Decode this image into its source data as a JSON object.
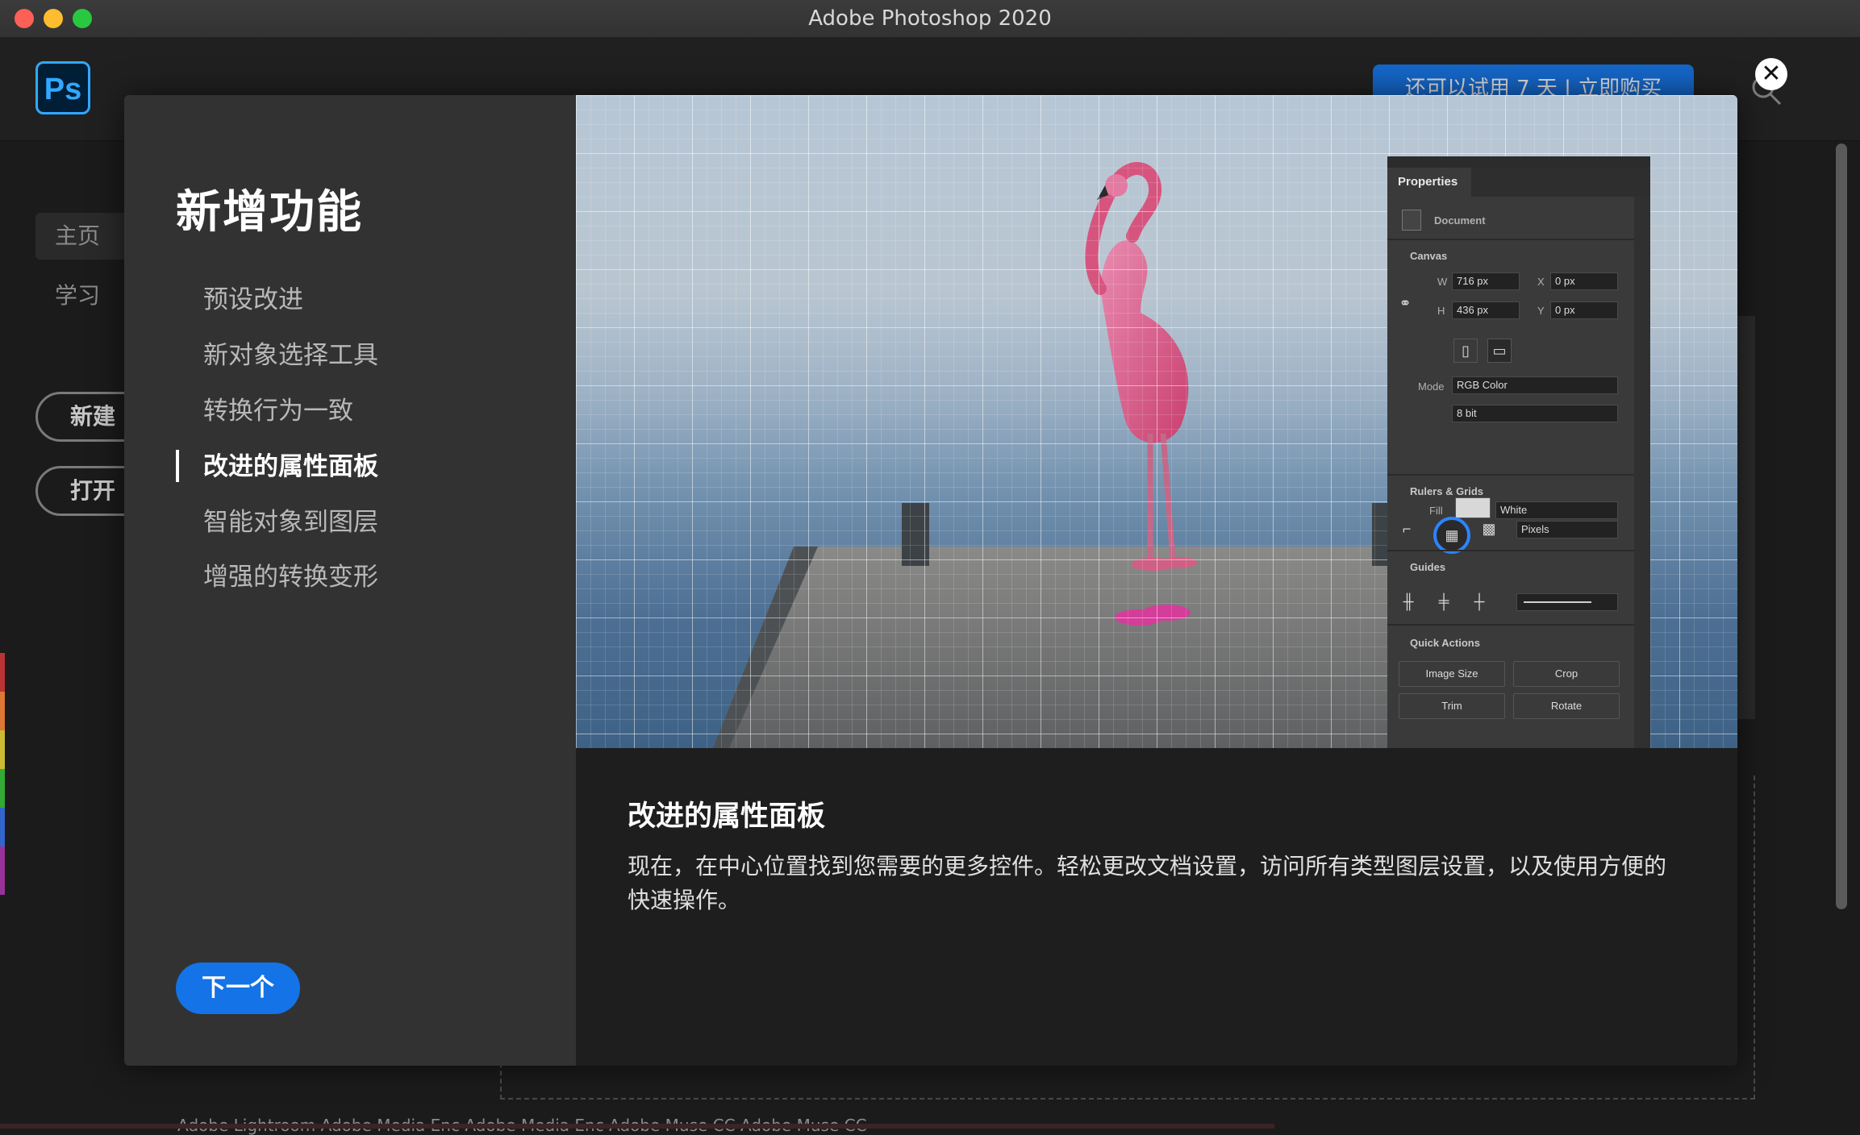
{
  "window": {
    "title": "Adobe Photoshop 2020"
  },
  "app": {
    "logo": "Ps",
    "trial_banner": "还可以试用 7 天 | 立即购买",
    "sidebar": {
      "items": [
        {
          "label": "主页"
        },
        {
          "label": "学习"
        }
      ]
    },
    "buttons": {
      "new": "新建",
      "open": "打开"
    },
    "footer_apps": "Adobe Lightroom  Adobe Media Enc  Adobe Media Enc  Adobe Muse CC  Adobe Muse CC"
  },
  "modal": {
    "title": "新增功能",
    "features": [
      {
        "label": "预设改进"
      },
      {
        "label": "新对象选择工具"
      },
      {
        "label": "转换行为一致"
      },
      {
        "label": "改进的属性面板"
      },
      {
        "label": "智能对象到图层"
      },
      {
        "label": "增强的转换变形"
      }
    ],
    "active_index": 3,
    "next_button": "下一个",
    "close_symbol": "✕",
    "detail": {
      "title": "改进的属性面板",
      "body": "现在，在中心位置找到您需要的更多控件。轻松更改文档设置，访问所有类型图层设置，以及使用方便的快速操作。"
    },
    "properties_panel": {
      "tab": "Properties",
      "document": "Document",
      "canvas_heading": "Canvas",
      "w_label": "W",
      "w_value": "716 px",
      "h_label": "H",
      "h_value": "436 px",
      "x_label": "X",
      "x_value": "0 px",
      "y_label": "Y",
      "y_value": "0 px",
      "mode_label": "Mode",
      "mode_value": "RGB Color",
      "bit_value": "8 bit",
      "fill_label": "Fill",
      "fill_value": "White",
      "rulers_heading": "Rulers & Grids",
      "units_value": "Pixels",
      "guides_heading": "Guides",
      "quick_actions_heading": "Quick Actions",
      "quick_actions": [
        "Image Size",
        "Crop",
        "Trim",
        "Rotate"
      ]
    }
  },
  "colors": {
    "accent": "#1473e6",
    "ps_blue": "#31a8ff",
    "modal_left": "#323232",
    "modal_right": "#1e1e1e"
  }
}
